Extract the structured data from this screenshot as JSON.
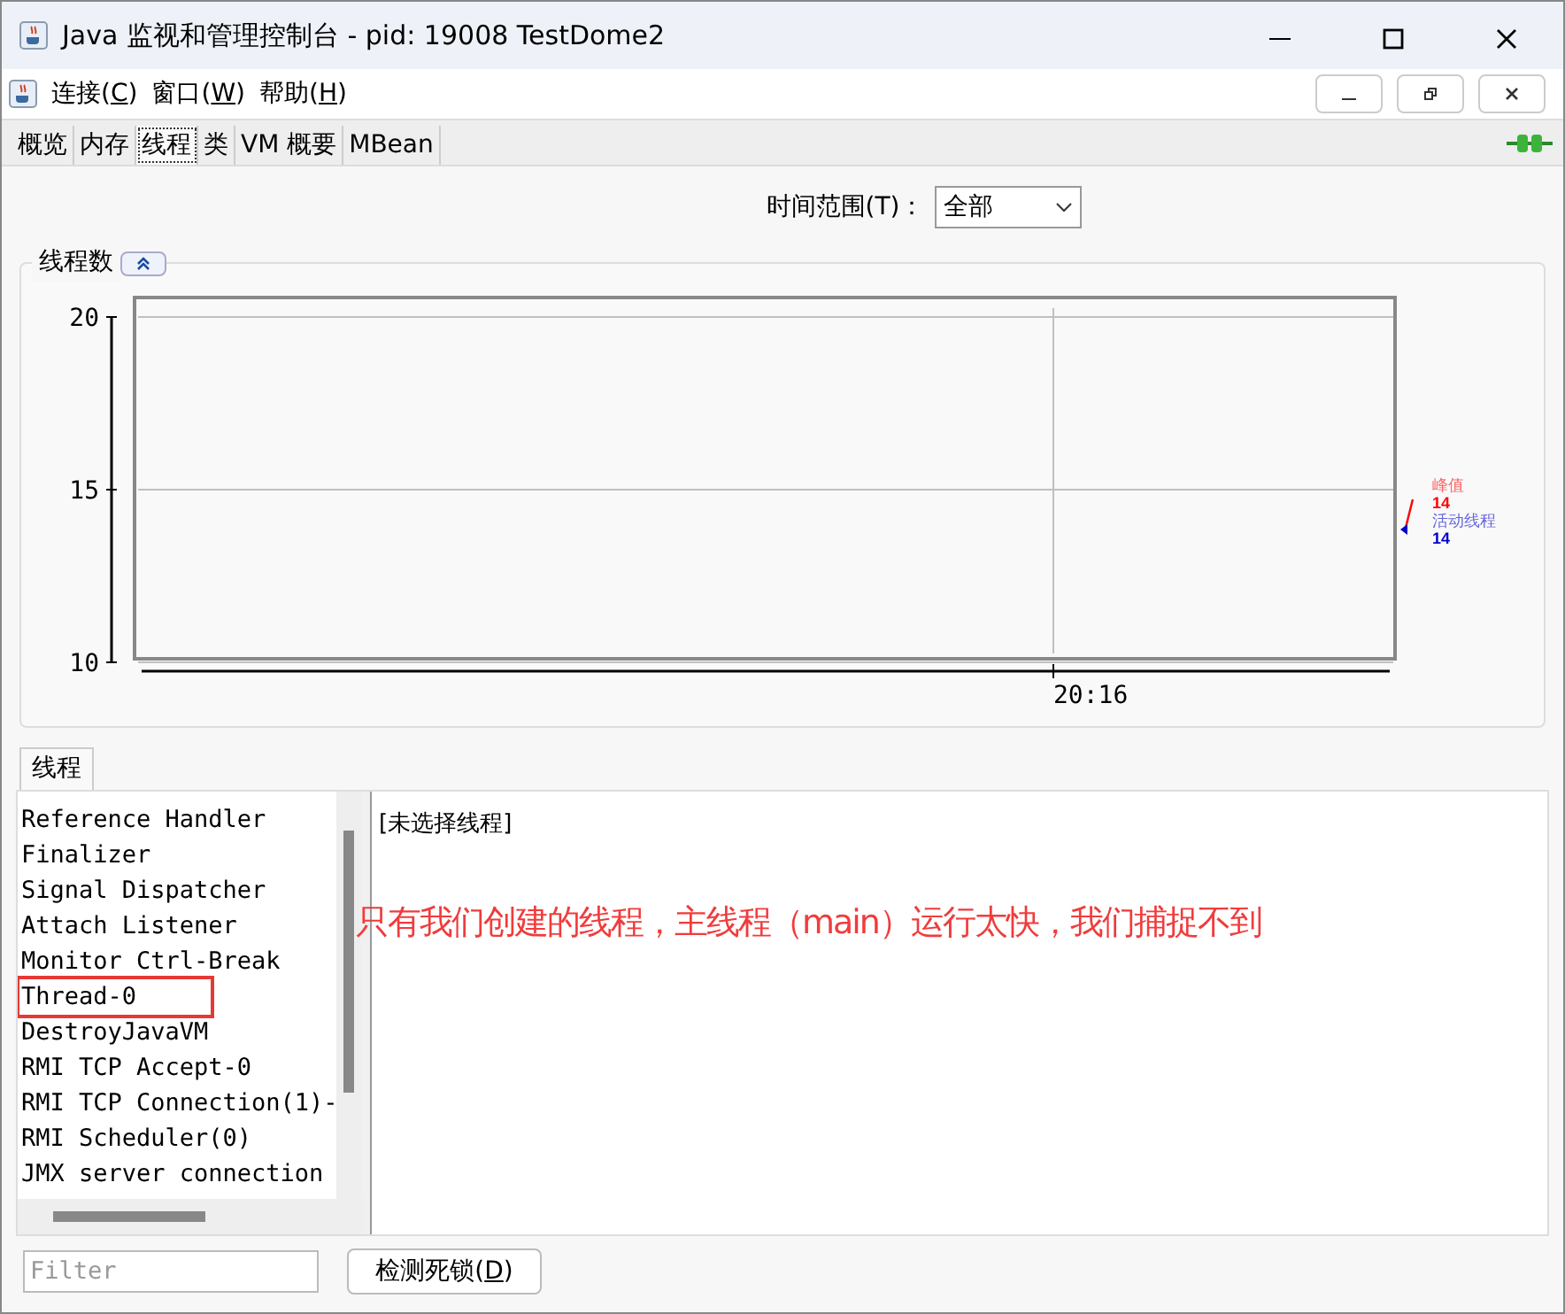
{
  "window": {
    "title": "Java 监视和管理控制台 - pid: 19008 TestDome2"
  },
  "menu": [
    {
      "label": "连接(C)"
    },
    {
      "label": "窗口(W)"
    },
    {
      "label": "帮助(H)"
    }
  ],
  "tabs": [
    {
      "label": "概览",
      "selected": false
    },
    {
      "label": "内存",
      "selected": false
    },
    {
      "label": "线程",
      "selected": true
    },
    {
      "label": "类",
      "selected": false
    },
    {
      "label": "VM 概要",
      "selected": false
    },
    {
      "label": "MBean",
      "selected": false
    }
  ],
  "time_range": {
    "label": "时间范围(T)：",
    "value": "全部"
  },
  "thread_count": {
    "title": "线程数",
    "chart_data": {
      "type": "line",
      "ylim": [
        10,
        20
      ],
      "yticks": [
        10,
        15,
        20
      ],
      "categories": [
        "20:16"
      ]
    },
    "legend": [
      {
        "name": "峰值",
        "value": "14",
        "color": "#ff0000"
      },
      {
        "name": "活动线程",
        "value": "14",
        "color": "#0000cc"
      }
    ]
  },
  "threads_tab": {
    "label": "线程"
  },
  "threads": [
    {
      "name": "Reference Handler",
      "highlighted": false
    },
    {
      "name": "Finalizer",
      "highlighted": false
    },
    {
      "name": "Signal Dispatcher",
      "highlighted": false
    },
    {
      "name": "Attach Listener",
      "highlighted": false
    },
    {
      "name": "Monitor Ctrl-Break",
      "highlighted": false
    },
    {
      "name": "Thread-0",
      "highlighted": true
    },
    {
      "name": "DestroyJavaVM",
      "highlighted": false
    },
    {
      "name": "RMI TCP Accept-0",
      "highlighted": false
    },
    {
      "name": "RMI TCP Connection(1)-",
      "highlighted": false
    },
    {
      "name": "RMI Scheduler(0)",
      "highlighted": false
    },
    {
      "name": "JMX server connection",
      "highlighted": false
    }
  ],
  "detail": "[未选择线程]",
  "annotation": "只有我们创建的线程，主线程（main）运行太快，我们捕捉不到",
  "filter": {
    "placeholder": "Filter"
  },
  "detect_button": "检测死锁(D)"
}
